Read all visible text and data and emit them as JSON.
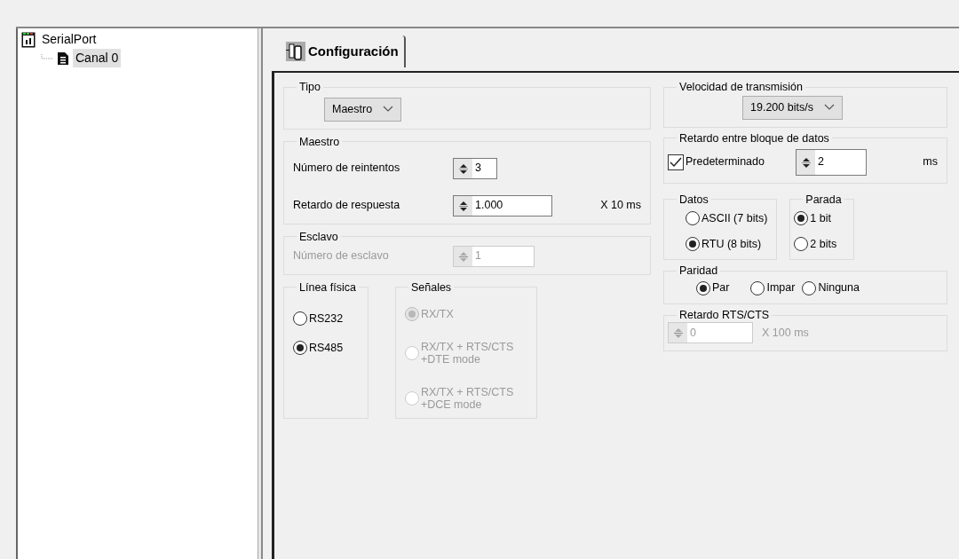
{
  "tree": [
    {
      "label": "SerialPort",
      "selected": false,
      "children": [
        {
          "label": "Canal 0",
          "selected": true
        }
      ]
    }
  ],
  "tabs": [
    {
      "label": "Configuración",
      "selected": true
    }
  ],
  "tipo": {
    "legend": "Tipo",
    "select": "Maestro"
  },
  "maestro": {
    "legend": "Maestro",
    "rows": [
      {
        "label": "Número de reintentos",
        "value": "3"
      },
      {
        "label": "Retardo de respuesta",
        "value": "1.000",
        "unit": "X 10 ms"
      }
    ]
  },
  "esclavo": {
    "legend": "Esclavo",
    "disabled": true,
    "rows": [
      {
        "label": "Número de esclavo",
        "value": "1"
      }
    ]
  },
  "linea_fisica": {
    "legend": "Línea física",
    "options": [
      {
        "label": "RS232",
        "selected": false
      },
      {
        "label": "RS485",
        "selected": true
      }
    ]
  },
  "senales": {
    "legend": "Señales",
    "disabled": true,
    "options": [
      {
        "label": "RX/TX",
        "selected": true
      },
      {
        "label": "RX/TX + RTS/CTS +DTE mode",
        "selected": false
      },
      {
        "label": "RX/TX + RTS/CTS +DCE mode",
        "selected": false
      }
    ]
  },
  "velocidad": {
    "legend": "Velocidad de transmisión",
    "select": "19.200 bits/s"
  },
  "retardo_bloque": {
    "legend": "Retardo entre bloque de datos",
    "checkbox": {
      "label": "Predeterminado",
      "checked": true
    },
    "value": "2",
    "unit": "ms"
  },
  "datos": {
    "legend": "Datos",
    "options": [
      {
        "label": "ASCII (7 bits)",
        "selected": false
      },
      {
        "label": "RTU (8 bits)",
        "selected": true
      }
    ]
  },
  "parada": {
    "legend": "Parada",
    "options": [
      {
        "label": "1 bit",
        "selected": true
      },
      {
        "label": "2 bits",
        "selected": false
      }
    ]
  },
  "paridad": {
    "legend": "Paridad",
    "options": [
      {
        "label": "Par",
        "selected": true
      },
      {
        "label": "Impar",
        "selected": false
      },
      {
        "label": "Ninguna",
        "selected": false
      }
    ]
  },
  "retardo_rts": {
    "legend": "Retardo RTS/CTS",
    "disabled": true,
    "value": "0",
    "unit": "X 100 ms"
  }
}
